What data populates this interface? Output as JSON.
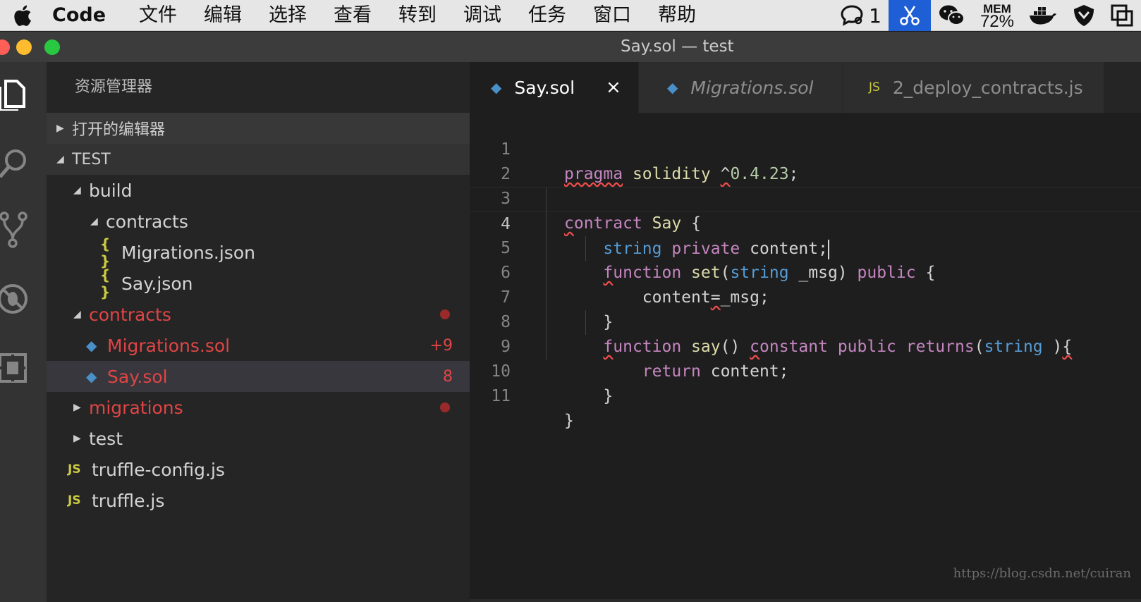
{
  "menubar": {
    "app": "Code",
    "items": [
      "文件",
      "编辑",
      "选择",
      "查看",
      "转到",
      "调试",
      "任务",
      "窗口",
      "帮助"
    ],
    "tray": {
      "notifications_count": "1",
      "mem_label": "MEM",
      "mem_value": "72%"
    }
  },
  "window": {
    "title": "Say.sol — test"
  },
  "sidebar": {
    "title": "资源管理器",
    "open_editors": "打开的编辑器",
    "root": "TEST",
    "tree": [
      {
        "label": "build",
        "depth": 1,
        "type": "folder-open"
      },
      {
        "label": "contracts",
        "depth": 2,
        "type": "folder-open"
      },
      {
        "label": "Migrations.json",
        "depth": 3,
        "type": "json"
      },
      {
        "label": "Say.json",
        "depth": 3,
        "type": "json"
      },
      {
        "label": "contracts",
        "depth": 1,
        "type": "folder-open",
        "modified": true,
        "dot": true
      },
      {
        "label": "Migrations.sol",
        "depth": 2,
        "type": "sol",
        "modified": true,
        "badge": "+9"
      },
      {
        "label": "Say.sol",
        "depth": 2,
        "type": "sol",
        "modified": true,
        "badge": "8",
        "selected": true
      },
      {
        "label": "migrations",
        "depth": 1,
        "type": "folder-closed",
        "modified": true,
        "dot": true
      },
      {
        "label": "test",
        "depth": 1,
        "type": "folder-closed"
      },
      {
        "label": "truffle-config.js",
        "depth": 1,
        "type": "js"
      },
      {
        "label": "truffle.js",
        "depth": 1,
        "type": "js"
      }
    ]
  },
  "tabs": [
    {
      "label": "Say.sol",
      "icon": "sol",
      "active": true,
      "close": "×"
    },
    {
      "label": "Migrations.sol",
      "icon": "sol",
      "italic": true
    },
    {
      "label": "2_deploy_contracts.js",
      "icon": "js"
    }
  ],
  "icons": {
    "js": "JS",
    "json": "{ }",
    "sol": "◆"
  },
  "code": {
    "current_line": 4,
    "line_numbers": [
      "1",
      "2",
      "3",
      "4",
      "5",
      "6",
      "7",
      "8",
      "9",
      "10",
      "11"
    ]
  },
  "watermark": "https://blog.csdn.net/cuiran",
  "colors": {
    "keyword": "#c586c0",
    "type": "#569cd6",
    "function": "#dcdcaa",
    "number": "#b5cea8",
    "error": "#f14c4c",
    "modified": "#e04545"
  }
}
